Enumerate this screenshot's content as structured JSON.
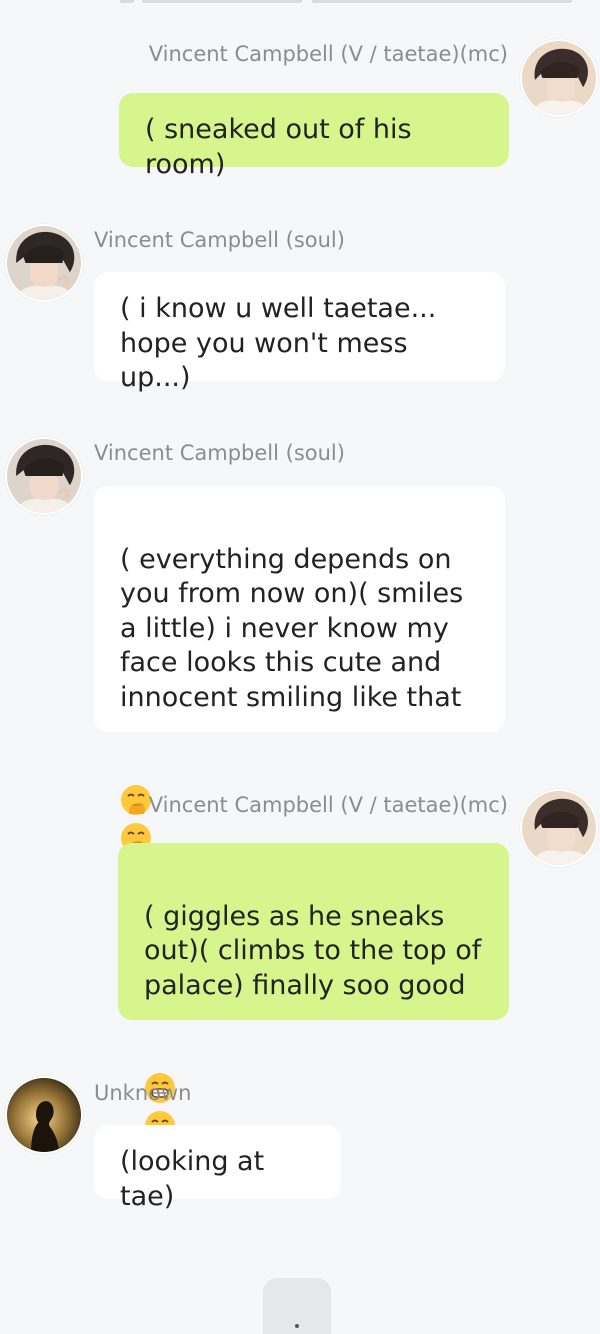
{
  "messages": [
    {
      "sender": "Vincent Campbell (V / taetae)(mc)",
      "text": "( sneaked out of his room)",
      "side": "right"
    },
    {
      "sender": "Vincent Campbell (soul)",
      "text": "( i know u well taetae...\nhope you won't mess up...)",
      "side": "left"
    },
    {
      "sender": "Vincent Campbell (soul)",
      "text": "( everything depends on\nyou from now on)( smiles\na little) i never know my\nface looks this cute and\ninnocent smiling like that",
      "emoji": "hand-over-mouth-emoji",
      "side": "left"
    },
    {
      "sender": "Vincent Campbell (V / taetae)(mc)",
      "text": "( giggles as he sneaks\nout)( climbs to the top of\npalace) finally soo good",
      "emoji": "grinning-face-emoji",
      "side": "right"
    },
    {
      "sender": "Unknown",
      "text": "(looking at tae)",
      "side": "left"
    }
  ],
  "colors": {
    "background": "#f6f7f9",
    "mc_bubble": "#d6f58d",
    "other_bubble": "#ffffff",
    "sender_text": "#8c8c8c"
  }
}
